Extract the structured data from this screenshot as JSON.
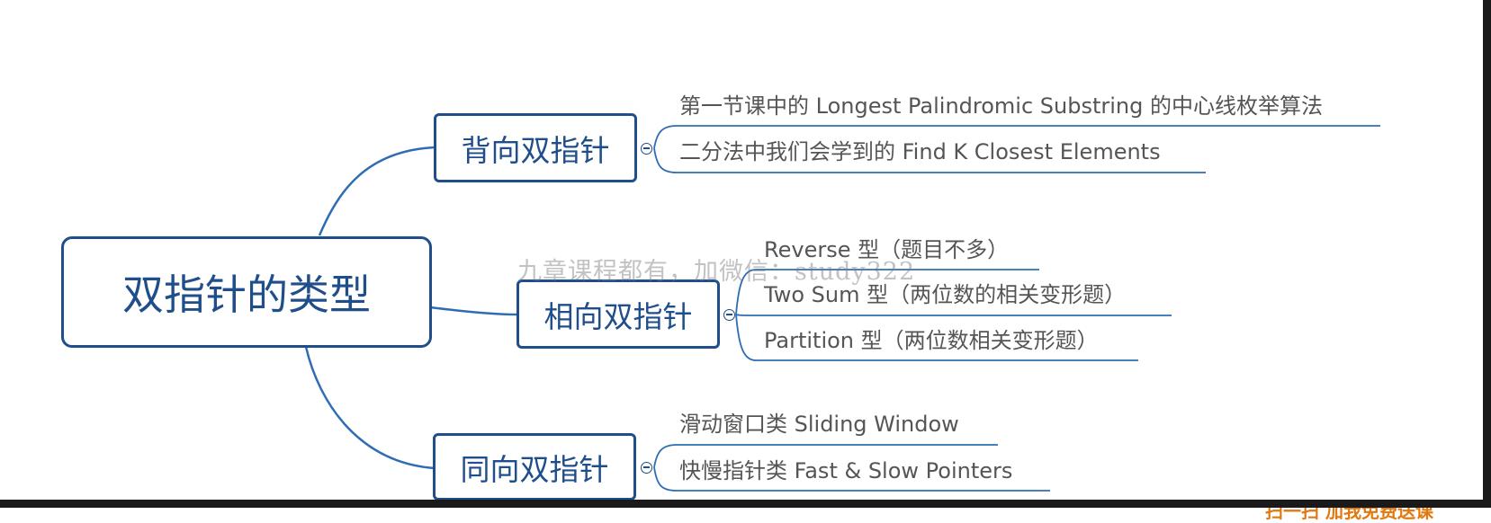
{
  "root": {
    "label": "双指针的类型"
  },
  "branches": [
    {
      "label": "背向双指针",
      "children": [
        "第一节课中的 Longest Palindromic Substring 的中心线枚举算法",
        "二分法中我们会学到的 Find K Closest Elements"
      ]
    },
    {
      "label": "相向双指针",
      "children": [
        "Reverse 型（题目不多）",
        "Two Sum 型（两位数的相关变形题）",
        "Partition 型（两位数相关变形题）"
      ]
    },
    {
      "label": "同向双指针",
      "children": [
        "滑动窗口类 Sliding Window",
        "快慢指针类 Fast & Slow Pointers"
      ]
    }
  ],
  "watermark": "九章课程都有，加微信：study322",
  "corner_promo": "扫一扫 加我免费送课",
  "colors": {
    "node_border": "#1f4e8a",
    "connector": "#2e6db4",
    "leaf_text": "#555555",
    "leaf_underline": "#2e6db4"
  }
}
